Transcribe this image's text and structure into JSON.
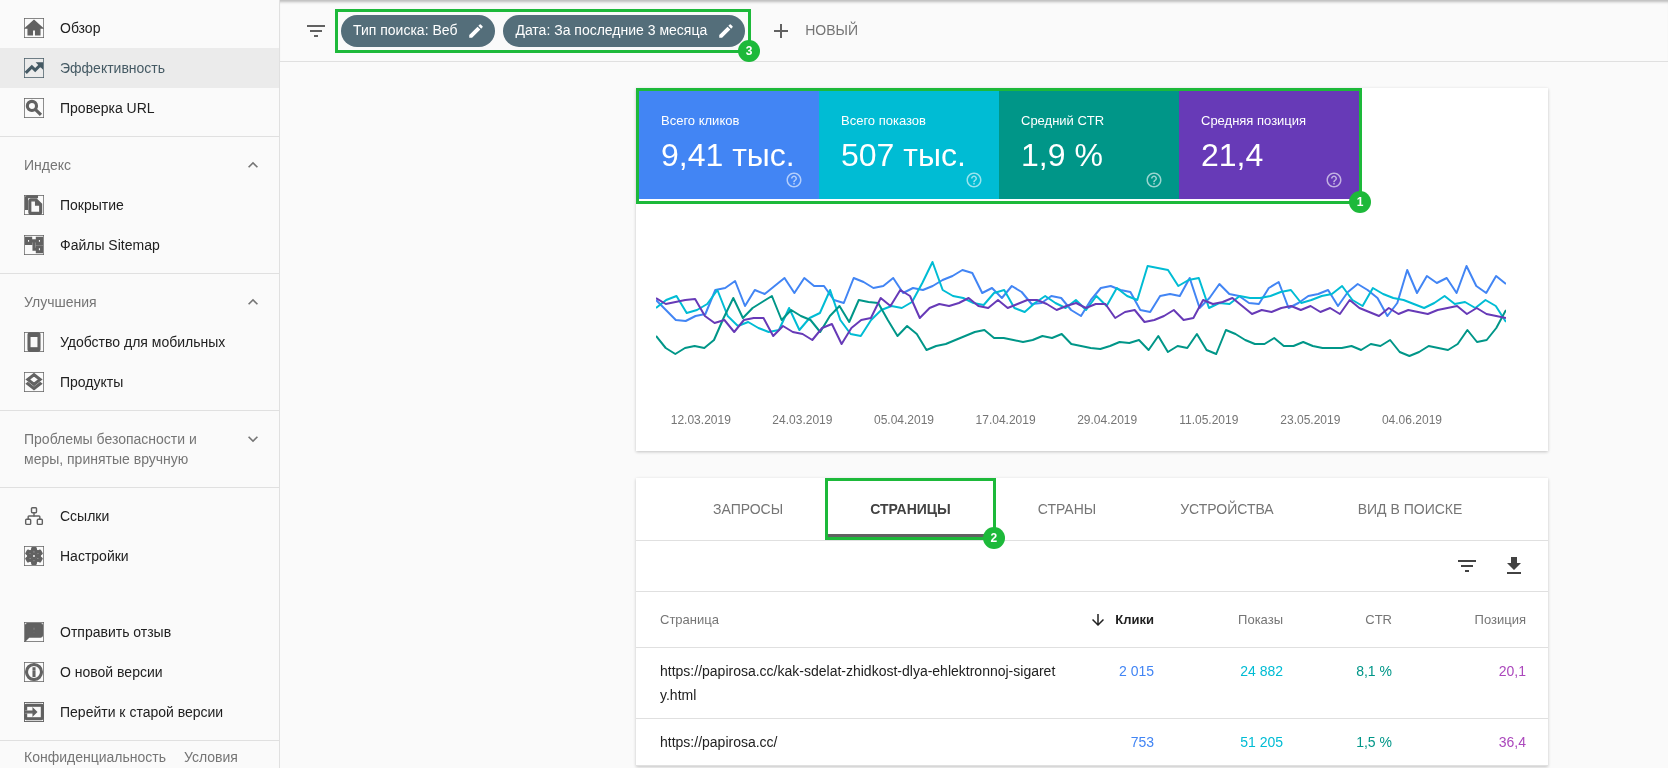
{
  "sidebar": {
    "sections": [
      {
        "items": [
          {
            "label": "Обзор",
            "selected": false
          },
          {
            "label": "Эффективность",
            "selected": true
          },
          {
            "label": "Проверка URL",
            "selected": false
          }
        ]
      },
      {
        "heading": "Индекс",
        "expanded": true,
        "items": [
          {
            "label": "Покрытие",
            "selected": false
          },
          {
            "label": "Файлы Sitemap",
            "selected": false
          }
        ]
      },
      {
        "heading": "Улучшения",
        "expanded": true,
        "items": [
          {
            "label": "Удобство для мобильных",
            "selected": false
          },
          {
            "label": "Продукты",
            "selected": false
          }
        ]
      },
      {
        "heading": "Проблемы безопасности и меры, принятые вручную",
        "expanded": false
      },
      {
        "items": [
          {
            "label": "Ссылки",
            "selected": false
          },
          {
            "label": "Настройки",
            "selected": false
          }
        ]
      }
    ],
    "bottom_items": [
      {
        "label": "Отправить отзыв",
        "selected": false
      },
      {
        "label": "О новой версии",
        "selected": false
      },
      {
        "label": "Перейти к старой версии",
        "selected": false
      }
    ],
    "footer_links": [
      "Конфиденциальность",
      "Условия"
    ]
  },
  "filter_bar": {
    "annotation": "3",
    "chips": [
      {
        "label": "Тип поиска: Веб"
      },
      {
        "label": "Дата: За последние 3 месяца"
      }
    ],
    "new_button": "НОВЫЙ"
  },
  "performance": {
    "annotation": "1",
    "metrics": [
      {
        "label": "Всего кликов",
        "value": "9,41 тыс.",
        "color": "#4285f4",
        "selected": true
      },
      {
        "label": "Всего показов",
        "value": "507 тыс.",
        "color": "#00bcd4",
        "selected": true
      },
      {
        "label": "Средний CTR",
        "value": "1,9 %",
        "color": "#009688",
        "selected": true
      },
      {
        "label": "Средняя позиция",
        "value": "21,4",
        "color": "#673ab7",
        "selected": true
      }
    ],
    "chart": {
      "x_labels": [
        "12.03.2019",
        "24.03.2019",
        "05.04.2019",
        "17.04.2019",
        "29.04.2019",
        "11.05.2019",
        "23.05.2019",
        "04.06.2019"
      ]
    }
  },
  "report": {
    "tabs": [
      {
        "label": "ЗАПРОСЫ",
        "selected": false
      },
      {
        "label": "СТРАНИЦЫ",
        "selected": true,
        "annotation": "2"
      },
      {
        "label": "СТРАНЫ",
        "selected": false
      },
      {
        "label": "УСТРОЙСТВА",
        "selected": false
      },
      {
        "label": "ВИД В ПОИСКЕ",
        "selected": false
      }
    ],
    "table": {
      "columns": [
        {
          "label": "Страница",
          "sorted": false
        },
        {
          "label": "Клики",
          "sorted": true,
          "color": "#4285f4"
        },
        {
          "label": "Показы",
          "sorted": false,
          "color": "#00bcd4"
        },
        {
          "label": "CTR",
          "sorted": false,
          "color": "#009688"
        },
        {
          "label": "Позиция",
          "sorted": false,
          "color": "#ab47bc"
        }
      ],
      "rows": [
        {
          "cells": [
            "https://papirosa.cc/kak-sdelat-zhidkost-dlya-ehlektronnoj-sigarety.html",
            "2 015",
            "24 882",
            "8,1 %",
            "20,1"
          ]
        },
        {
          "cells": [
            "https://papirosa.cc/",
            "753",
            "51 205",
            "1,5 %",
            "36,4"
          ]
        }
      ]
    }
  }
}
